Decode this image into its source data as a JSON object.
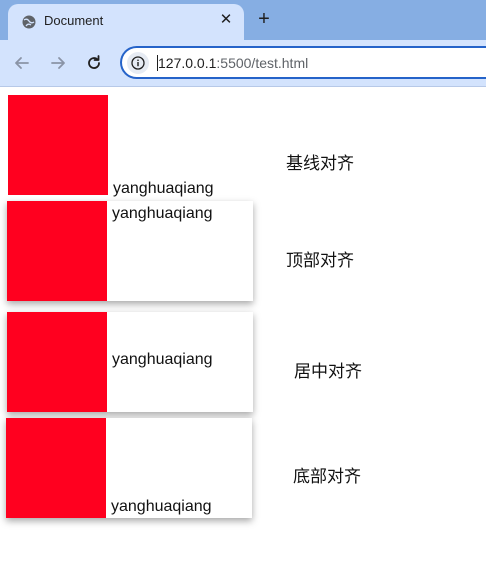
{
  "browser": {
    "tab_title": "Document",
    "tab_close_glyph": "✕",
    "new_tab_glyph": "+",
    "url_host": "127.0.0.1",
    "url_rest": ":5500/test.html",
    "icons": [
      "globe-icon",
      "close-icon",
      "plus-icon",
      "back-arrow-icon",
      "forward-arrow-icon",
      "reload-icon",
      "info-icon"
    ]
  },
  "demos": [
    {
      "text": "yanghuaqiang",
      "label": "基线对齐"
    },
    {
      "text": "yanghuaqiang",
      "label": "顶部对齐"
    },
    {
      "text": "yanghuaqiang",
      "label": "居中对齐"
    },
    {
      "text": "yanghuaqiang",
      "label": "底部对齐"
    }
  ],
  "colors": {
    "red_box": "#ff001f",
    "tabstrip": "#86aee3",
    "toolbar": "#d3e3fd",
    "omnibox_border": "#2563c9"
  }
}
